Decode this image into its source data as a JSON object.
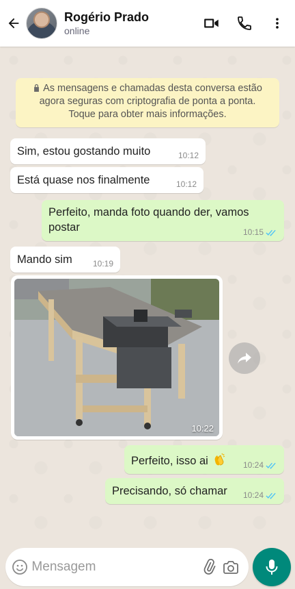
{
  "header": {
    "contact_name": "Rogério Prado",
    "status": "online",
    "icons": [
      "arrow-back-icon",
      "video-call-icon",
      "phone-icon",
      "more-vert-icon"
    ]
  },
  "system_message": {
    "text": "As mensagens e chamadas desta conversa estão agora seguras com criptografia de ponta a ponta. Toque para obter mais informações.",
    "line1": "As mensagens e chamadas desta conversa estão",
    "line2": "agora seguras com criptografia de ponta a ponta.",
    "line3": "Toque para obter mais informações."
  },
  "messages": [
    {
      "direction": "in",
      "text": "Sim, estou gostando muito",
      "time": "10:12"
    },
    {
      "direction": "in",
      "text": "Está quase nos finalmente",
      "time": "10:12"
    },
    {
      "direction": "out",
      "text": "Perfeito, manda foto quando der, vamos postar",
      "line1": "Perfeito, manda foto quando der, vamos",
      "line2": "postar",
      "time": "10:15",
      "status": "read"
    },
    {
      "direction": "in",
      "text": "Mando sim",
      "time": "10:19"
    },
    {
      "direction": "in",
      "type": "image",
      "alt": "foto da mesa de serra",
      "time": "10:22"
    },
    {
      "direction": "out",
      "text": "Perfeito, isso ai",
      "emoji": "clapping-hands",
      "time": "10:24",
      "status": "read"
    },
    {
      "direction": "out",
      "text": "Precisando, só chamar",
      "time": "10:24",
      "status": "read"
    }
  ],
  "composer": {
    "placeholder": "Mensagem",
    "icons": [
      "emoji-icon",
      "attach-icon",
      "camera-icon",
      "mic-icon"
    ]
  },
  "colors": {
    "chat_background": "#ece5dd",
    "incoming_bubble": "#ffffff",
    "outgoing_bubble": "#dcf8c6",
    "system_bubble": "#fcf4c4",
    "read_ticks": "#4fc3f7",
    "accent": "#00897b"
  }
}
